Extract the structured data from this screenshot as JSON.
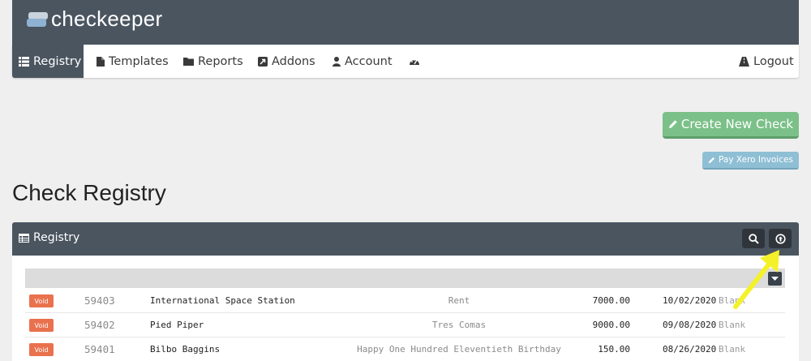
{
  "app": {
    "logo_text": "checkeeper"
  },
  "nav": {
    "registry": "Registry",
    "templates": "Templates",
    "reports": "Reports",
    "addons": "Addons",
    "account": "Account",
    "logout": "Logout"
  },
  "actions": {
    "create_check": "Create New Check",
    "pay_xero": "Pay Xero Invoices"
  },
  "page": {
    "title": "Check Registry"
  },
  "panel": {
    "title": "Registry"
  },
  "table": {
    "rows": [
      {
        "badge": "Void",
        "number": "59403",
        "payee": "International Space Station",
        "memo": "Rent",
        "amount": "7000.00",
        "date": "10/02/2020",
        "status": "Blank"
      },
      {
        "badge": "Void",
        "number": "59402",
        "payee": "Pied Piper",
        "memo": "Tres Comas",
        "amount": "9000.00",
        "date": "09/08/2020",
        "status": "Blank"
      },
      {
        "badge": "Void",
        "number": "59401",
        "payee": "Bilbo Baggins",
        "memo": "Happy One Hundred Eleventieth Birthday",
        "amount": "150.00",
        "date": "08/26/2020",
        "status": "Blank"
      }
    ]
  },
  "colors": {
    "header_bg": "#4a5560",
    "create_button": "#7bc088",
    "xero_button": "#8fbfd4",
    "void_badge": "#e9714d",
    "annotation_arrow": "#f4f12a"
  },
  "icons": {
    "registry": "list-icon",
    "templates": "file-icon",
    "reports": "folder-icon",
    "addons": "external-link-icon",
    "account": "user-icon",
    "dashboard": "dashboard-icon",
    "logout": "road-icon",
    "create": "pencil-icon",
    "panel": "table-icon",
    "search": "search-icon",
    "upload": "upload-circle-icon",
    "sort": "caret-down-icon"
  }
}
